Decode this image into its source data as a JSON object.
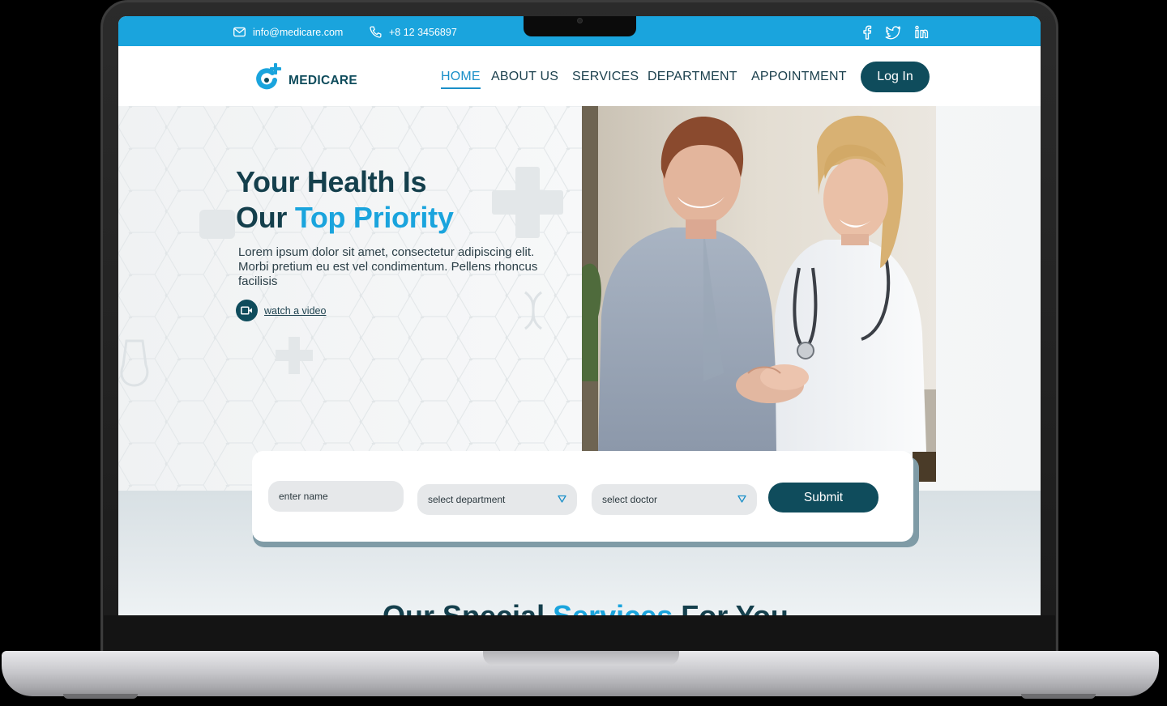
{
  "topbar": {
    "email": "info@medicare.com",
    "phone": "+8 12 3456897",
    "socials": [
      "facebook-icon",
      "twitter-icon",
      "linkedin-icon"
    ]
  },
  "brand": {
    "name": "MEDICARE"
  },
  "nav": {
    "items": [
      "HOME",
      "ABOUT US",
      "SERVICES",
      "DEPARTMENT",
      "APPOINTMENT"
    ],
    "active": "HOME",
    "login_label": "Log In"
  },
  "hero": {
    "headline_line1": "Your Health Is",
    "headline_line2_prefix": "Our ",
    "headline_line2_accent": "Top Priority",
    "description": "Lorem ipsum dolor sit amet, consectetur adipiscing elit. Morbi pretium eu est vel condimentum. Pellens rhoncus facilisis",
    "watch_label": "watch a video"
  },
  "appointment_form": {
    "name_placeholder": "enter name",
    "department_placeholder": "select department",
    "doctor_placeholder": "select doctor",
    "submit_label": "Submit"
  },
  "services": {
    "title_prefix": "Our Special ",
    "title_accent": "Services",
    "title_suffix": " For You"
  },
  "colors": {
    "primary": "#1aa4dd",
    "dark": "#0f4c5c",
    "text": "#143f4c"
  }
}
